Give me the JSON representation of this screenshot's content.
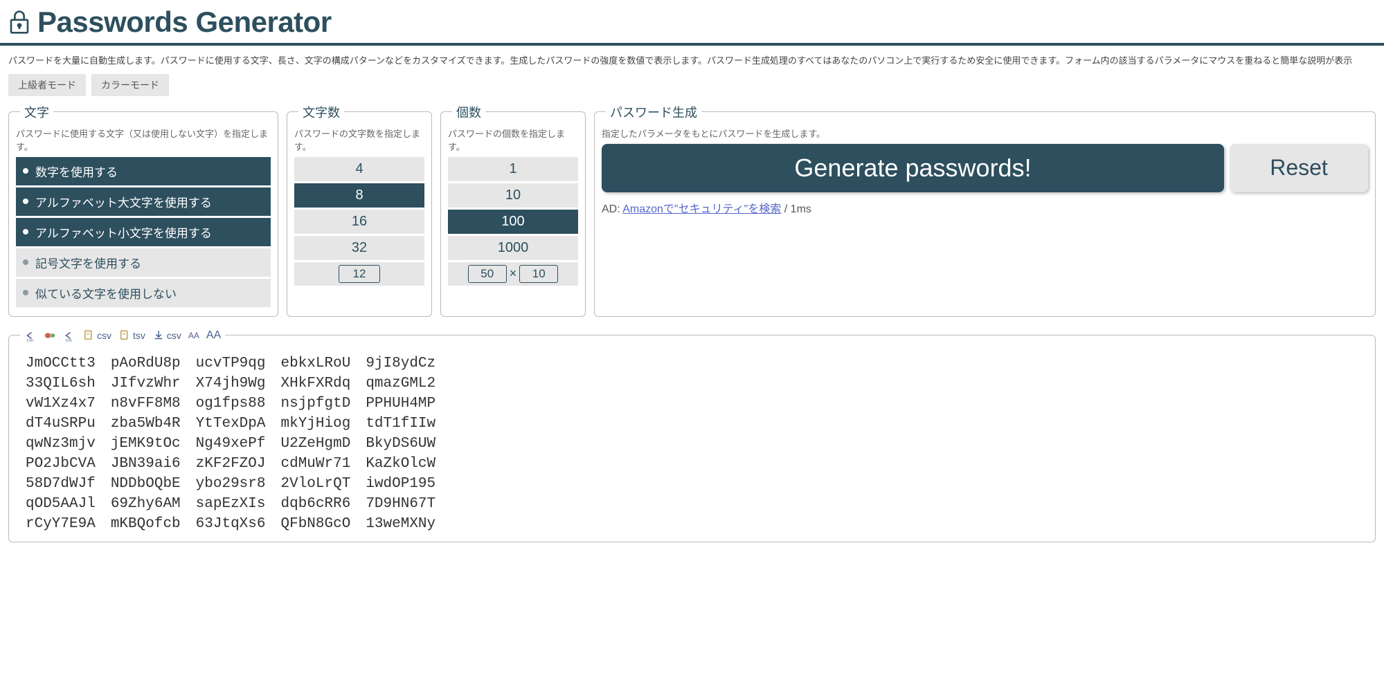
{
  "header": {
    "title": "Passwords Generator"
  },
  "description": "パスワードを大量に自動生成します。パスワードに使用する文字、長さ、文字の構成パターンなどをカスタマイズできます。生成したパスワードの強度を数値で表示します。パスワード生成処理のすべてはあなたのパソコン上で実行するため安全に使用できます。フォーム内の該当するパラメータにマウスを重ねると簡単な説明が表示",
  "top_buttons": {
    "advanced": "上級者モード",
    "color": "カラーモード"
  },
  "panels": {
    "chars": {
      "legend": "文字",
      "desc": "パスワードに使用する文字（又は使用しない文字）を指定します。",
      "items": [
        {
          "label": "数字を使用する",
          "active": true
        },
        {
          "label": "アルファベット大文字を使用する",
          "active": true
        },
        {
          "label": "アルファベット小文字を使用する",
          "active": true
        },
        {
          "label": "記号文字を使用する",
          "active": false
        },
        {
          "label": "似ている文字を使用しない",
          "active": false
        }
      ]
    },
    "length": {
      "legend": "文字数",
      "desc": "パスワードの文字数を指定します。",
      "options": [
        {
          "label": "4",
          "active": false
        },
        {
          "label": "8",
          "active": true
        },
        {
          "label": "16",
          "active": false
        },
        {
          "label": "32",
          "active": false
        }
      ],
      "custom": "12"
    },
    "count": {
      "legend": "個数",
      "desc": "パスワードの個数を指定します。",
      "options": [
        {
          "label": "1",
          "active": false
        },
        {
          "label": "10",
          "active": false
        },
        {
          "label": "100",
          "active": true
        },
        {
          "label": "1000",
          "active": false
        }
      ],
      "custom_a": "50",
      "custom_sep": "×",
      "custom_b": "10"
    },
    "generate": {
      "legend": "パスワード生成",
      "desc": "指定したパラメータをもとにパスワードを生成します。",
      "generate_label": "Generate passwords!",
      "reset_label": "Reset",
      "ad_prefix": "AD: ",
      "ad_link": "Amazonで\"セキュリティ\"を検索",
      "ad_suffix": " / 1ms"
    }
  },
  "toolbar": {
    "csv_copy": "csv",
    "tsv_copy": "tsv",
    "csv_download": "csv"
  },
  "passwords": [
    [
      "JmOCCtt3",
      "pAoRdU8p",
      "ucvTP9qg",
      "ebkxLRoU",
      "9jI8ydCz"
    ],
    [
      "33QIL6sh",
      "JIfvzWhr",
      "X74jh9Wg",
      "XHkFXRdq",
      "qmazGML2"
    ],
    [
      "vW1Xz4x7",
      "n8vFF8M8",
      "og1fps88",
      "nsjpfgtD",
      "PPHUH4MP"
    ],
    [
      "dT4uSRPu",
      "zba5Wb4R",
      "YtTexDpA",
      "mkYjHiog",
      "tdT1fIIw"
    ],
    [
      "qwNz3mjv",
      "jEMK9tOc",
      "Ng49xePf",
      "U2ZeHgmD",
      "BkyDS6UW"
    ],
    [
      "PO2JbCVA",
      "JBN39ai6",
      "zKF2FZOJ",
      "cdMuWr71",
      "KaZkOlcW"
    ],
    [
      "58D7dWJf",
      "NDDbOQbE",
      "ybo29sr8",
      "2VloLrQT",
      "iwdOP195"
    ],
    [
      "qOD5AAJl",
      "69Zhy6AM",
      "sapEzXIs",
      "dqb6cRR6",
      "7D9HN67T"
    ],
    [
      "rCyY7E9A",
      "mKBQofcb",
      "63JtqXs6",
      "QFbN8GcO",
      "13weMXNy"
    ]
  ]
}
